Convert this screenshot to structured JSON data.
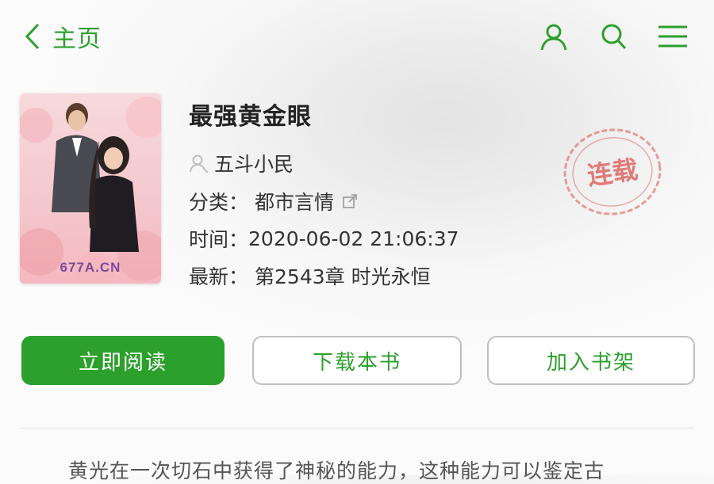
{
  "header": {
    "back_label": "主页",
    "icons": [
      "back-chevron-icon",
      "user-icon",
      "search-icon",
      "menu-icon"
    ]
  },
  "book": {
    "title": "最强黄金眼",
    "author": "五斗小民",
    "category_label": "分类：",
    "category": "都市言情",
    "time_label": "时间：",
    "time": "2020-06-02 21:06:37",
    "latest_label": "最新：",
    "latest": "第2543章 时光永恒",
    "cover_watermark": "677A.CN",
    "status_stamp": "连载"
  },
  "actions": {
    "read": "立即阅读",
    "download": "下载本书",
    "add_shelf": "加入书架"
  },
  "intro": {
    "text": "黄光在一次切石中获得了神秘的能力，这种能力可以鉴定古"
  },
  "colors": {
    "accent": "#2ca02c",
    "stamp": "#d9534f"
  }
}
